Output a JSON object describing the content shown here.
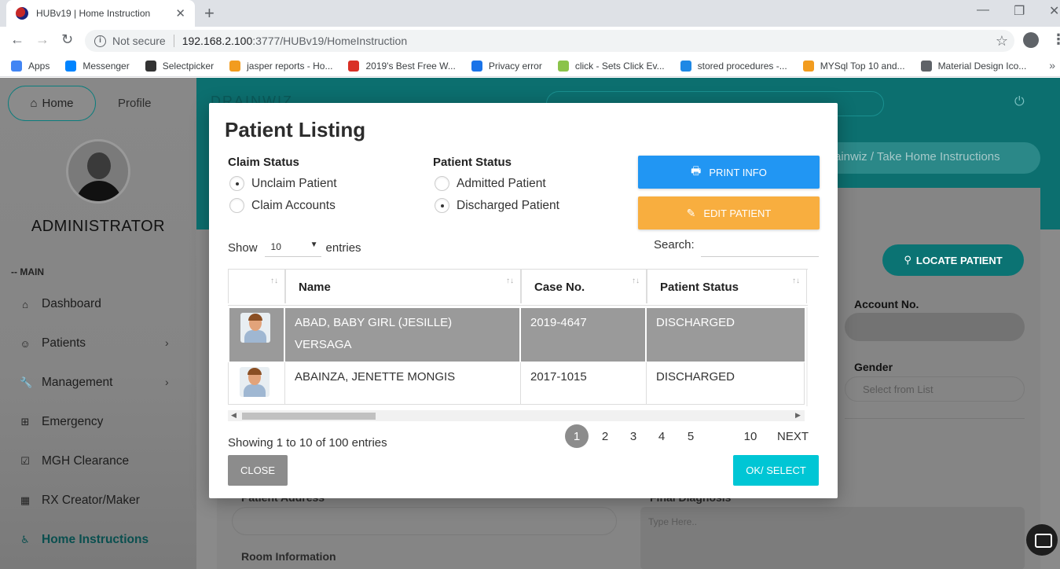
{
  "browser": {
    "tab_title": "HUBv19 | Home Instruction",
    "not_secure": "Not secure",
    "url_host": "192.168.2.100",
    "url_path": ":3777/HUBv19/HomeInstruction",
    "bookmarks": [
      {
        "label": "Apps",
        "color": "#4285f4"
      },
      {
        "label": "Messenger",
        "color": "#0084ff"
      },
      {
        "label": "Selectpicker",
        "color": "#333333"
      },
      {
        "label": "jasper reports - Ho...",
        "color": "#f29c1f"
      },
      {
        "label": "2019's Best Free W...",
        "color": "#d93025"
      },
      {
        "label": "Privacy error",
        "color": "#1a73e8"
      },
      {
        "label": "click - Sets Click Ev...",
        "color": "#8bc34a"
      },
      {
        "label": "stored procedures -...",
        "color": "#1e88e5"
      },
      {
        "label": "MYSql Top 10 and...",
        "color": "#f29c1f"
      },
      {
        "label": "Material Design Ico...",
        "color": "#5f6368"
      }
    ]
  },
  "sidebar": {
    "home_tab": "Home",
    "profile_tab": "Profile",
    "admin_name": "ADMINISTRATOR",
    "section_label": "-- MAIN",
    "items": [
      {
        "label": "Dashboard",
        "icon": "home-icon",
        "glyph": "⌂",
        "chevron": false
      },
      {
        "label": "Patients",
        "icon": "patients-icon",
        "glyph": "☺",
        "chevron": true
      },
      {
        "label": "Management",
        "icon": "wrench-icon",
        "glyph": "🔧",
        "chevron": true
      },
      {
        "label": "Emergency",
        "icon": "plus-box-icon",
        "glyph": "⊞",
        "chevron": false
      },
      {
        "label": "MGH Clearance",
        "icon": "checkbox-icon",
        "glyph": "☑",
        "chevron": false
      },
      {
        "label": "RX Creator/Maker",
        "icon": "grid-icon",
        "glyph": "▦",
        "chevron": false
      },
      {
        "label": "Home Instructions",
        "icon": "wheelchair-icon",
        "glyph": "♿",
        "chevron": false,
        "active": true
      }
    ]
  },
  "background": {
    "brand": "DRAINWIZ",
    "breadcrumb": "ainwiz  /  Take Home Instructions",
    "locate_button": "LOCATE PATIENT",
    "account_label": "Account No.",
    "gender_label": "Gender",
    "gender_placeholder": "Select from List",
    "address_label": "Patient Address",
    "diagnosis_label": "Final Diagnosis",
    "diagnosis_placeholder": "Type Here..",
    "room_label": "Room Information"
  },
  "modal": {
    "title": "Patient Listing",
    "claim_status": {
      "title": "Claim Status",
      "options": [
        {
          "label": "Unclaim Patient",
          "checked": true
        },
        {
          "label": "Claim Accounts",
          "checked": false
        }
      ]
    },
    "patient_status": {
      "title": "Patient Status",
      "options": [
        {
          "label": "Admitted Patient",
          "checked": false
        },
        {
          "label": "Discharged Patient",
          "checked": true
        }
      ]
    },
    "print_button": "PRINT INFO",
    "edit_button": "EDIT PATIENT",
    "show_label": "Show",
    "entries_value": "10",
    "entries_label": "entries",
    "search_label": "Search:",
    "columns": [
      "",
      "Name",
      "Case  No.",
      "Patient  Status"
    ],
    "rows": [
      {
        "name": "ABAD, BABY GIRL (JESILLE) VERSAGA",
        "case_no": "2019-4647",
        "status": "DISCHARGED",
        "selected": true
      },
      {
        "name": "ABAINZA, JENETTE MONGIS",
        "case_no": "2017-1015",
        "status": "DISCHARGED",
        "selected": false
      }
    ],
    "info": "Showing 1 to 10 of 100 entries",
    "pages": [
      "1",
      "2",
      "3",
      "4",
      "5",
      "10",
      "NEXT"
    ],
    "current_page": "1",
    "close_button": "CLOSE",
    "ok_button": "OK/ SELECT"
  }
}
